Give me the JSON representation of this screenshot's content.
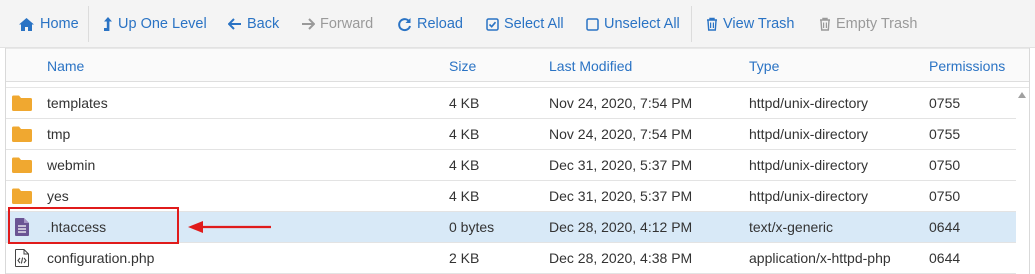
{
  "toolbar": {
    "home": "Home",
    "up_one_level": "Up One Level",
    "back": "Back",
    "forward": "Forward",
    "reload": "Reload",
    "select_all": "Select All",
    "unselect_all": "Unselect All",
    "view_trash": "View Trash",
    "empty_trash": "Empty Trash"
  },
  "columns": {
    "name": "Name",
    "size": "Size",
    "last_modified": "Last Modified",
    "type": "Type",
    "permissions": "Permissions"
  },
  "rows": [
    {
      "icon": "folder-icon",
      "name": "templates",
      "size": "4 KB",
      "modified": "Nov 24, 2020, 7:54 PM",
      "type": "httpd/unix-directory",
      "perms": "0755"
    },
    {
      "icon": "folder-icon",
      "name": "tmp",
      "size": "4 KB",
      "modified": "Nov 24, 2020, 7:54 PM",
      "type": "httpd/unix-directory",
      "perms": "0755"
    },
    {
      "icon": "folder-icon",
      "name": "webmin",
      "size": "4 KB",
      "modified": "Dec 31, 2020, 5:37 PM",
      "type": "httpd/unix-directory",
      "perms": "0750"
    },
    {
      "icon": "folder-icon",
      "name": "yes",
      "size": "4 KB",
      "modified": "Dec 31, 2020, 5:37 PM",
      "type": "httpd/unix-directory",
      "perms": "0750"
    },
    {
      "icon": "text-file-icon",
      "name": ".htaccess",
      "size": "0 bytes",
      "modified": "Dec 28, 2020, 4:12 PM",
      "type": "text/x-generic",
      "perms": "0644",
      "selected": true
    },
    {
      "icon": "code-file-icon",
      "name": "configuration.php",
      "size": "2 KB",
      "modified": "Dec 28, 2020, 4:38 PM",
      "type": "application/x-httpd-php",
      "perms": "0644"
    }
  ],
  "colors": {
    "accent": "#2a73c4",
    "folder": "#f0a830",
    "selected_row": "#d8e9f7",
    "annotation": "#e01b1b"
  }
}
